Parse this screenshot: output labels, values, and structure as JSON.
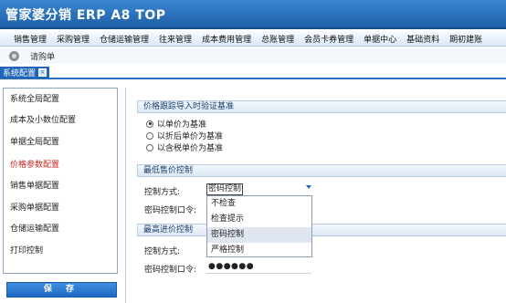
{
  "app": {
    "title": "管家婆分销 ERP A8 TOP"
  },
  "menu": [
    "销售管理",
    "采购管理",
    "仓储运输管理",
    "往来管理",
    "成本费用管理",
    "总账管理",
    "会员卡券管理",
    "单据中心",
    "基础资料",
    "期初建账"
  ],
  "toolbar": {
    "label": "请购单",
    "icon": "gear-icon"
  },
  "tab": {
    "label": "系统配置",
    "close_icon": "close-icon"
  },
  "sidebar": {
    "items": [
      "系统全局配置",
      "成本及小数位配置",
      "单据全局配置",
      "价格参数配置",
      "销售单据配置",
      "采购单据配置",
      "仓储运输配置",
      "打印控制"
    ],
    "active_index": 3,
    "active_color": "#d11f1f",
    "save_label": "保 存"
  },
  "section1": {
    "title": "价格跟踪导入时验证基准",
    "options": [
      "以单价为基准",
      "以折后单价为基准",
      "以含税单价为基准"
    ],
    "selected_index": 0
  },
  "section2": {
    "title": "最低售价控制",
    "control_label": "控制方式:",
    "control_value": "密码控制",
    "password_label": "密码控制口令:"
  },
  "dropdown": {
    "options": [
      "不检查",
      "检查提示",
      "密码控制",
      "严格控制"
    ],
    "highlighted_index": 2
  },
  "section3": {
    "title": "最高进价控制",
    "control_label": "控制方式:",
    "password_label": "密码控制口令:",
    "password_mask": "●●●●●●"
  },
  "colors": {
    "accent": "#1f66bb",
    "title_bar": "#2a72c2"
  }
}
